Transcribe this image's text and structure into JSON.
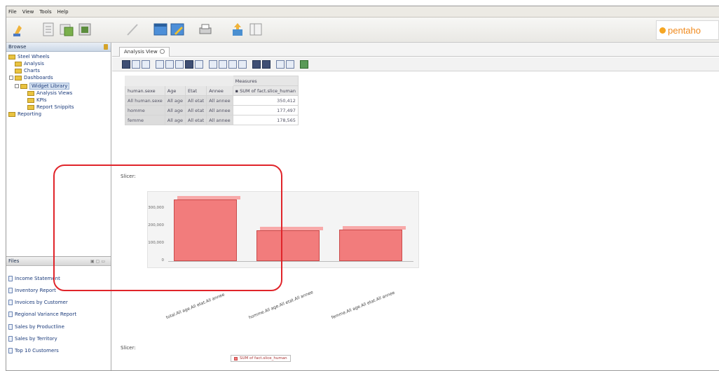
{
  "menu": [
    "File",
    "View",
    "Tools",
    "Help"
  ],
  "logo_text": "pentaho",
  "browse": {
    "title": "Browse",
    "items": [
      {
        "label": "Steel Wheels",
        "level": 0
      },
      {
        "label": "Analysis",
        "level": 1
      },
      {
        "label": "Charts",
        "level": 1
      },
      {
        "label": "Dashboards",
        "level": 1
      },
      {
        "label": "Widget Library",
        "level": 2
      },
      {
        "label": "Analysis Views",
        "level": 3
      },
      {
        "label": "KPIs",
        "level": 3
      },
      {
        "label": "Report Snippits",
        "level": 3
      },
      {
        "label": "Reporting",
        "level": 1
      }
    ]
  },
  "files": {
    "title": "Files",
    "items": [
      "Income Statement",
      "Inventory Report",
      "Invoices by Customer",
      "Regional Variance Report",
      "Sales by Productline",
      "Sales by Territory",
      "Top 10 Customers"
    ]
  },
  "tab": {
    "label": "Analysis View"
  },
  "pivot": {
    "measures_header": "Measures",
    "measure_name": "SUM of fact.slice_human",
    "columns": [
      "human.sexe",
      "Age",
      "Etat",
      "Annee"
    ],
    "rows": [
      {
        "cells": [
          "All human.sexe",
          "All age",
          "All etat",
          "All annee"
        ],
        "value": "350,412"
      },
      {
        "cells": [
          "homme",
          "All age",
          "All etat",
          "All annee"
        ],
        "value": "177,497"
      },
      {
        "cells": [
          "femme",
          "All age",
          "All etat",
          "All annee"
        ],
        "value": "178,565"
      }
    ]
  },
  "chart_labels": {
    "above": "Slicer:",
    "below": "Slicer:"
  },
  "chart_data": {
    "type": "bar",
    "categories": [
      "total.All age.All etat.All annee",
      "homme.All age.All etat.All annee",
      "femme.All age.All etat.All annee"
    ],
    "series": [
      {
        "name": "SUM of fact.slice_human",
        "values": [
          350412,
          177497,
          178565
        ]
      }
    ],
    "yticks": [
      "300,000",
      "200,000",
      "100,000",
      "0"
    ],
    "ylim": [
      0,
      400000
    ]
  },
  "colors": {
    "bar": "#f27c7c",
    "highlight": "#e0242a"
  }
}
